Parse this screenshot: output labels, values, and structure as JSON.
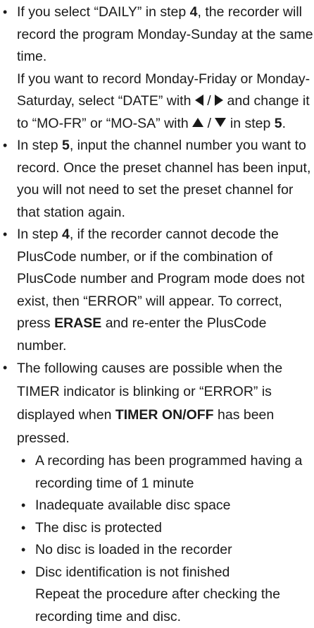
{
  "bullets": [
    {
      "a1": "If you select “DAILY” in step ",
      "a2": "4",
      "a3": ", the recorder will record the program Monday-Sunday at the same time.",
      "b1": "If you want to record Monday-Friday or Monday-Saturday, select “DATE” with ",
      "b2": " / ",
      "b3": " and change it to “MO-FR” or “MO-SA” with ",
      "b4": " / ",
      "b5": " in step ",
      "b6": "5",
      "b7": "."
    },
    {
      "a1": "In step ",
      "a2": "5",
      "a3": ", input the channel number you want to record. Once the preset channel has been input, you will not need to set the preset channel for that station again."
    },
    {
      "a1": "In step ",
      "a2": "4",
      "a3": ", if the recorder cannot decode the PlusCode number, or if the combination of PlusCode number and Program mode does not exist, then “ERROR” will appear. To correct, press ",
      "a4": "ERASE",
      "a5": " and re-enter the PlusCode number."
    },
    {
      "a1": "The following causes are possible when the TIMER indicator is blinking or “ERROR” is displayed when ",
      "a2": "TIMER ON/OFF",
      "a3": " has been pressed."
    }
  ],
  "causes": [
    "A recording has been programmed having a recording time of 1 minute",
    "Inadequate available disc space",
    "The disc is protected",
    "No disc is loaded in the recorder",
    "Disc identification is not finished"
  ],
  "closing": "Repeat the procedure after checking the recording time and disc.",
  "bullet_glyph": "•",
  "icons": [
    "left-triangle-icon",
    "right-triangle-icon",
    "up-triangle-icon",
    "down-triangle-icon"
  ]
}
